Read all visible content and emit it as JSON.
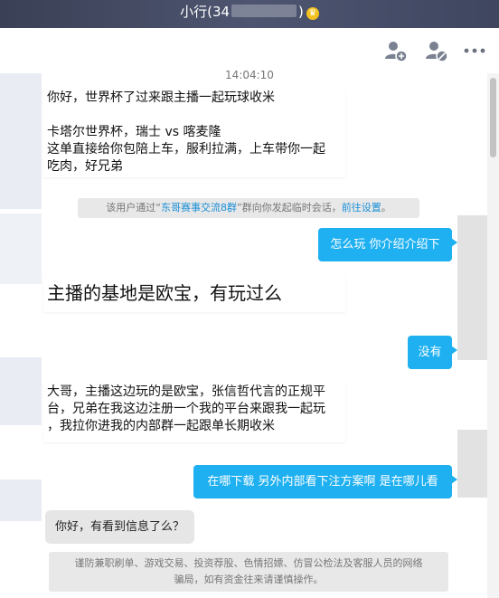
{
  "title": {
    "name_prefix": "小行(34",
    "name_suffix": ")",
    "badge_icon": "crown-icon"
  },
  "toolbar": {
    "icons": [
      "add-friend-icon",
      "block-user-icon",
      "more-icon"
    ]
  },
  "messages": {
    "timestamp": "14:04:10",
    "m1_line1": "你好，世界杯了过来跟主播一起玩球收米",
    "m1_line2": "卡塔尔世界杯，瑞士 vs 喀麦隆",
    "m1_line3": "这单直接给你包陪上车，服利拉满，上车带你一起",
    "m1_line4": "吃肉，好兄弟",
    "notice_pre": "该用户通过“",
    "notice_group": "东哥赛事交流8群",
    "notice_mid": "”群向你发起临时会话，",
    "notice_link": "前往设置",
    "notice_end": "。",
    "out1": "怎么玩  你介绍介绍下",
    "m2": "主播的基地是欧宝，有玩过么",
    "out2": "没有",
    "m3_line1": "大哥，主播这边玩的是欧宝，张信哲代言的正规平",
    "m3_line2": "台，兄弟在我这边注册一个我的平台来跟我一起玩",
    "m3_line3": "，我拉你进我的内部群一起跟单长期收米",
    "out3": "在哪下载  另外内部看下注方案啊  是在哪儿看",
    "m4": "你好，有看到信息了么？",
    "warn_line1": "谨防兼职刷单、游戏交易、投资荐股、色情招嫖、仿冒公检法及客服人员的网络",
    "warn_line2": "骗局，如有资金往来请谨慎操作。"
  }
}
